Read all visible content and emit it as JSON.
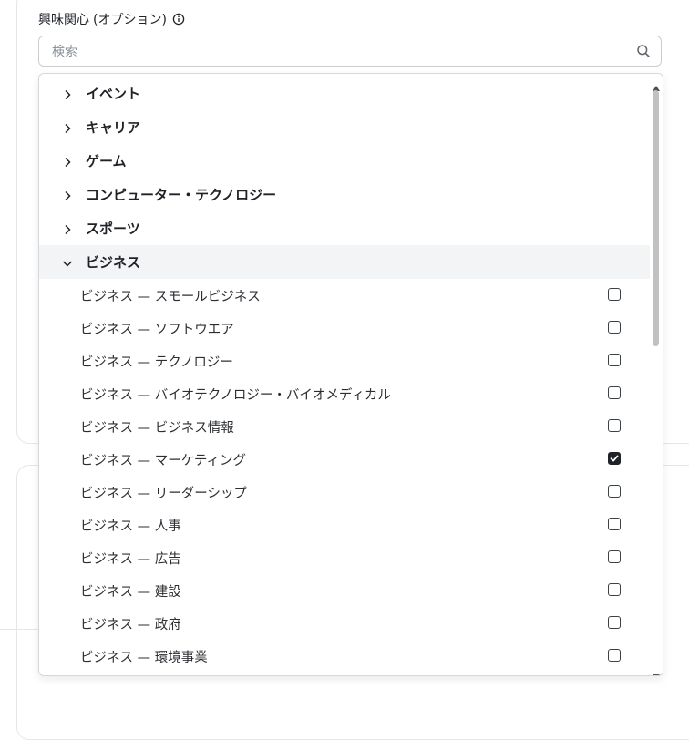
{
  "field": {
    "label": "興味関心",
    "optional": "(オプション)",
    "info_icon": "info-icon"
  },
  "search": {
    "placeholder": "検索",
    "value": "",
    "icon": "search-icon"
  },
  "categories": [
    {
      "label": "イベント",
      "expanded": false
    },
    {
      "label": "キャリア",
      "expanded": false
    },
    {
      "label": "ゲーム",
      "expanded": false
    },
    {
      "label": "コンピューター・テクノロジー",
      "expanded": false
    },
    {
      "label": "スポーツ",
      "expanded": false
    },
    {
      "label": "ビジネス",
      "expanded": true
    }
  ],
  "business_items": [
    {
      "label": "ビジネス — スモールビジネス",
      "checked": false
    },
    {
      "label": "ビジネス — ソフトウエア",
      "checked": false
    },
    {
      "label": "ビジネス — テクノロジー",
      "checked": false
    },
    {
      "label": "ビジネス — バイオテクノロジー・バイオメディカル",
      "checked": false
    },
    {
      "label": "ビジネス — ビジネス情報",
      "checked": false
    },
    {
      "label": "ビジネス — マーケティング",
      "checked": true
    },
    {
      "label": "ビジネス — リーダーシップ",
      "checked": false
    },
    {
      "label": "ビジネス — 人事",
      "checked": false
    },
    {
      "label": "ビジネス — 広告",
      "checked": false
    },
    {
      "label": "ビジネス — 建設",
      "checked": false
    },
    {
      "label": "ビジネス — 政府",
      "checked": false
    },
    {
      "label": "ビジネス — 環境事業",
      "checked": false
    }
  ],
  "colors": {
    "accent": "#1f2328",
    "expanded_row_bg": "#f3f4f5",
    "border": "#d5d8dc"
  }
}
